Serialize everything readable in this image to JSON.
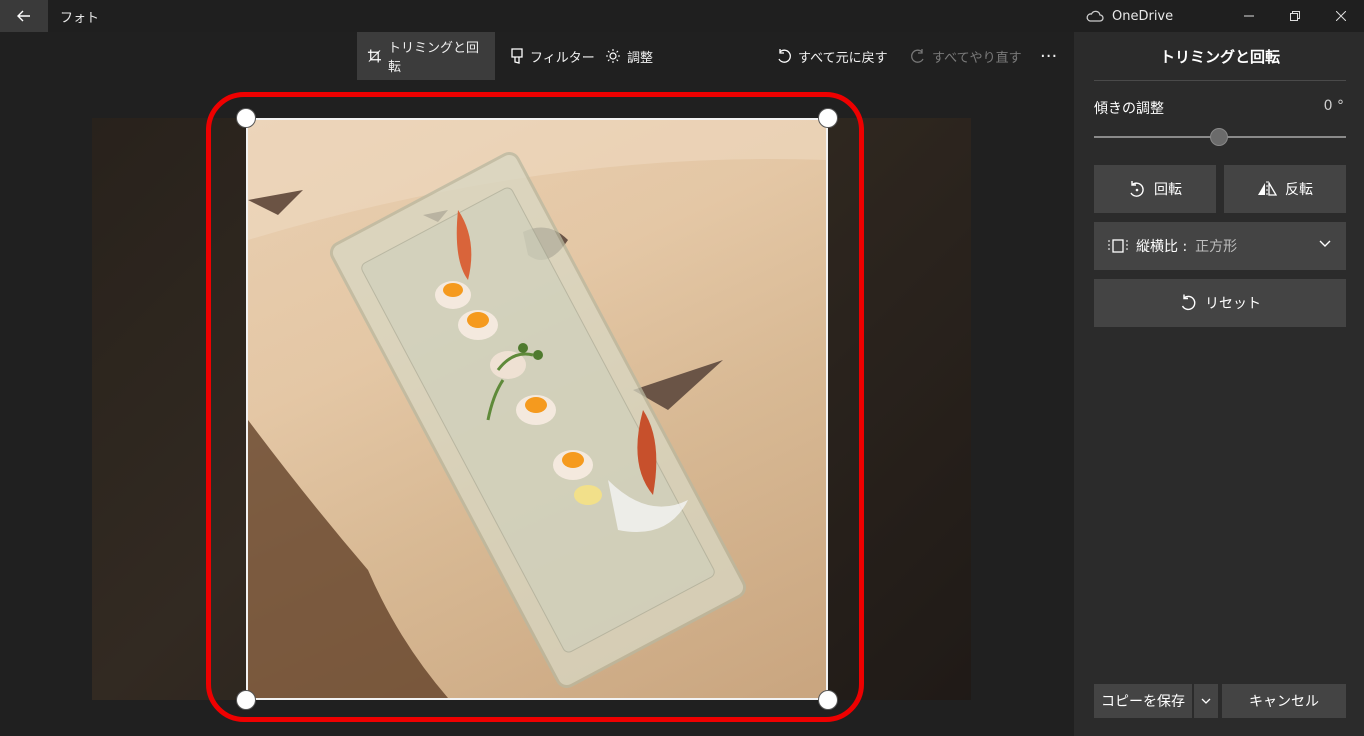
{
  "titlebar": {
    "app_title": "フォト",
    "account": "OneDrive",
    "icons": [
      "back-arrow-icon",
      "cloud-icon",
      "minimize-icon",
      "restore-icon",
      "close-icon"
    ]
  },
  "toolbar": {
    "crop_rotate": "トリミングと回転",
    "filter": "フィルター",
    "adjust": "調整",
    "undo_all": "すべて元に戻す",
    "redo_all": "すべてやり直す",
    "more": "···"
  },
  "panel": {
    "title": "トリミングと回転",
    "tilt_label": "傾きの調整",
    "tilt_value": "0 °",
    "tilt_level": 0.5,
    "rotate": "回転",
    "flip": "反転",
    "aspect_label": "縦横比 : ",
    "aspect_value": "正方形",
    "reset": "リセット",
    "save_copy": "コピーを保存",
    "cancel": "キャンセル"
  },
  "colors": {
    "highlight": "#ee0000",
    "panel_bg": "#2b2b2b",
    "button_bg": "#444444"
  }
}
